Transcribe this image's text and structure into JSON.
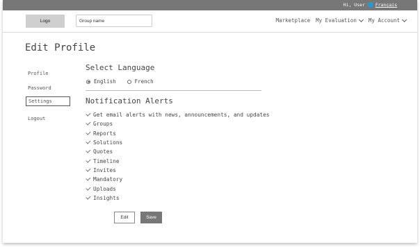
{
  "topbar": {
    "greeting": "Hi, User",
    "language_link": "Français",
    "globe_icon": "globe-icon"
  },
  "header": {
    "logo": "Logo",
    "group_name": "Group name",
    "nav": [
      {
        "label": "Marketplace",
        "has_chevron": false
      },
      {
        "label": "My Evaluation",
        "has_chevron": true
      },
      {
        "label": "My Account",
        "has_chevron": true
      }
    ]
  },
  "page": {
    "title": "Edit Profile"
  },
  "sidebar": {
    "items": [
      {
        "label": "Profile"
      },
      {
        "label": "Password"
      },
      {
        "label": "Settings"
      },
      {
        "label": "Logout"
      }
    ],
    "active": "Settings"
  },
  "language": {
    "title": "Select Language",
    "options": [
      {
        "label": "English",
        "selected": true
      },
      {
        "label": "French",
        "selected": false
      }
    ]
  },
  "notifications": {
    "title": "Notification Alerts",
    "items": [
      {
        "label": "Get email alerts with news, announcements, and updates",
        "checked": true
      },
      {
        "label": "Groups",
        "checked": true
      },
      {
        "label": "Reports",
        "checked": true
      },
      {
        "label": "Solutions",
        "checked": true
      },
      {
        "label": "Quotes",
        "checked": true
      },
      {
        "label": "Timeline",
        "checked": true
      },
      {
        "label": "Invites",
        "checked": true
      },
      {
        "label": "Mandatory",
        "checked": true
      },
      {
        "label": "Uploads",
        "checked": true
      },
      {
        "label": "Insights",
        "checked": true
      }
    ]
  },
  "actions": {
    "edit": "Edit",
    "save": "Save"
  }
}
